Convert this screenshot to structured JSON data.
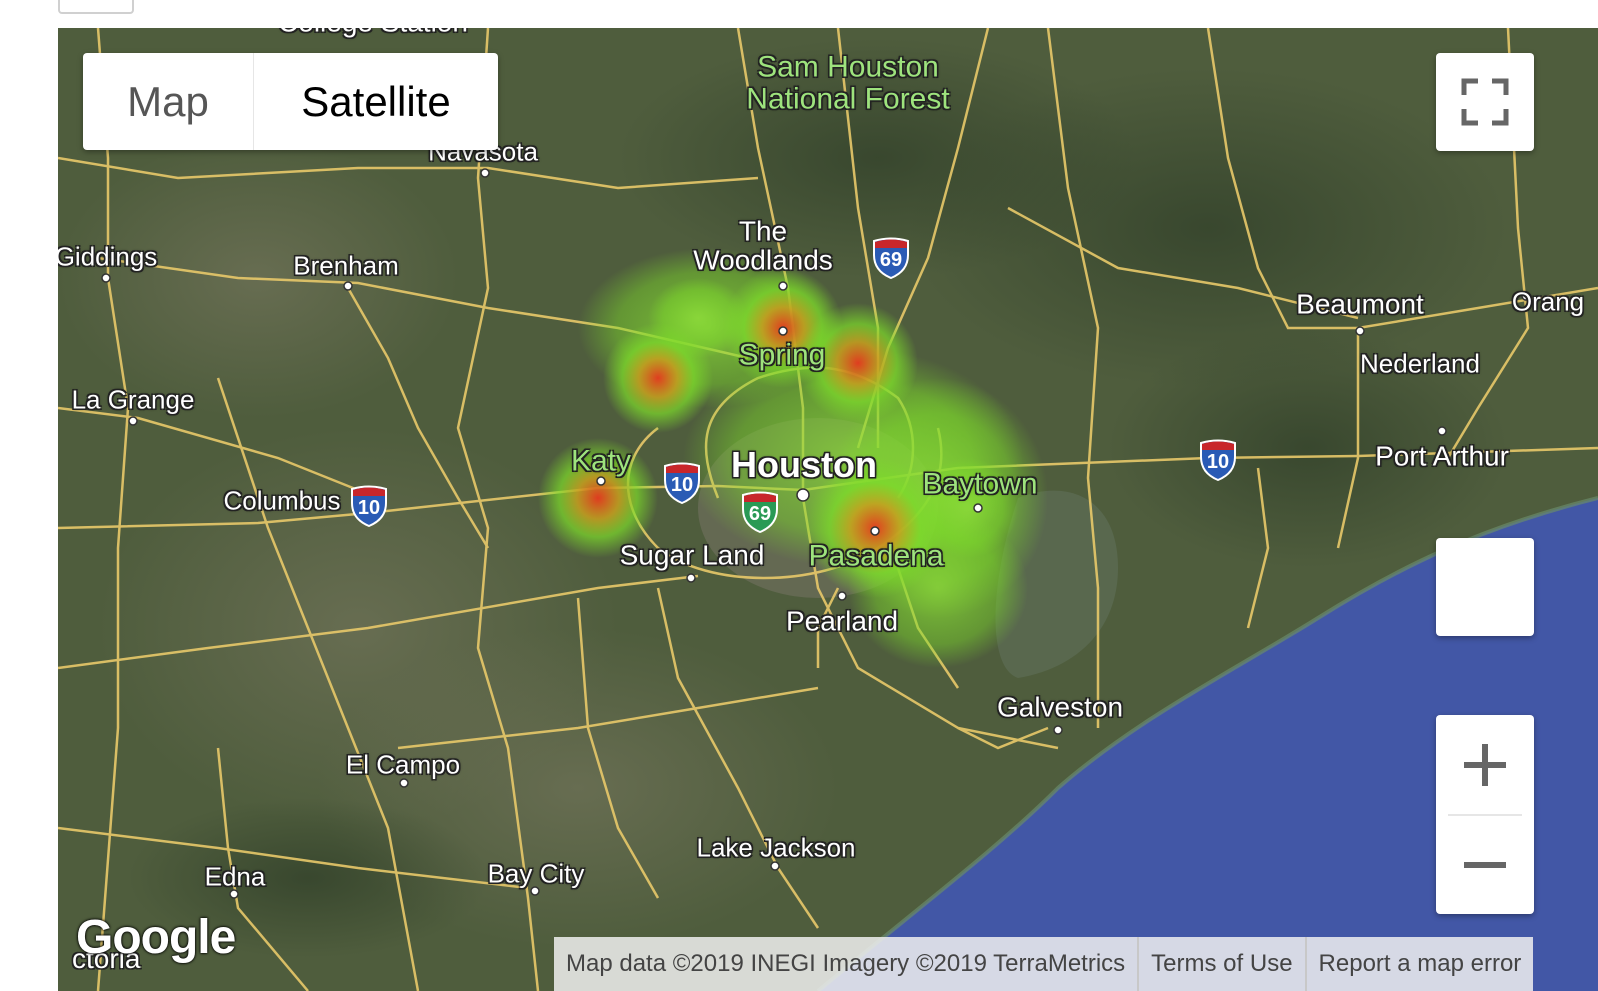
{
  "map_type_control": {
    "map_label": "Map",
    "satellite_label": "Satellite",
    "selected": "Satellite"
  },
  "controls": {
    "fullscreen_icon": "fullscreen-icon",
    "zoom_in_icon": "plus-icon",
    "zoom_out_icon": "minus-icon"
  },
  "places": {
    "college_station": "College Station",
    "sam_houston": "Sam Houston\nNational Forest",
    "navasota": "Navasota",
    "giddings": "Giddings",
    "brenham": "Brenham",
    "the_woodlands": "The\nWoodlands",
    "spring": "Spring",
    "beaumont": "Beaumont",
    "orange": "Orang",
    "nederland": "Nederland",
    "la_grange": "La Grange",
    "port_arthur": "Port Arthur",
    "katy": "Katy",
    "houston": "Houston",
    "baytown": "Baytown",
    "columbus": "Columbus",
    "sugar_land": "Sugar Land",
    "pasadena": "Pasadena",
    "pearland": "Pearland",
    "galveston": "Galveston",
    "el_campo": "El Campo",
    "lake_jackson": "Lake Jackson",
    "edna": "Edna",
    "bay_city": "Bay City",
    "victoria": "ctoria"
  },
  "shields": {
    "i69_north": "69",
    "i10_west": "10",
    "i10_mid": "10",
    "i69_south": "69",
    "i10_east": "10"
  },
  "footer": {
    "logo": "Google",
    "attribution": "Map data ©2019 INEGI Imagery ©2019 TerraMetrics",
    "terms": "Terms of Use",
    "report": "Report a map error"
  },
  "colors": {
    "land": "#4c5a3c",
    "water": "#4257a6",
    "roads": "#e8c96a",
    "heat_low": "#7ddc2a",
    "heat_high": "#e63a1e"
  }
}
